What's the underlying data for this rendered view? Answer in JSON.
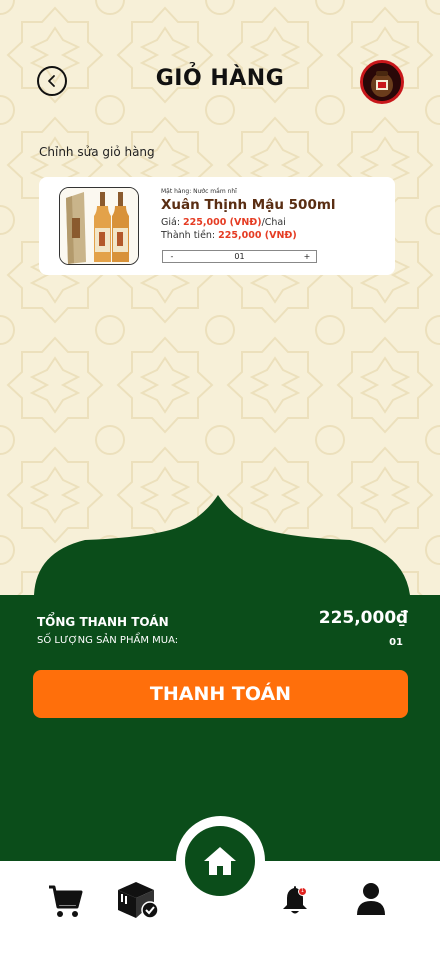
{
  "header": {
    "title": "GIỎ HÀNG"
  },
  "edit_cart_label": "Chỉnh sửa giỏ hàng",
  "cart_items": [
    {
      "category": "Mặt hàng: Nước mắm nhĩ",
      "name": "Xuân Thịnh Mậu 500ml",
      "price_label": "Giá: ",
      "price_value": "225,000 (VNĐ)",
      "price_unit": "/Chai",
      "total_label": "Thành tiền: ",
      "total_value": "225,000 (VNĐ)",
      "qty_minus": "-",
      "quantity": "01",
      "qty_plus": "+"
    }
  ],
  "summary": {
    "total_label": "TỔNG THANH TOÁN",
    "total_value": "225,000₫",
    "qty_label": "SỐ LƯỢNG SẢN PHẨM MUA:",
    "qty_value": "01"
  },
  "pay_button": "THANH TOÁN",
  "nav": {
    "items": [
      "cart-icon",
      "orders-icon",
      "home-icon",
      "bell-icon",
      "user-icon"
    ],
    "notification_badge": "1"
  },
  "colors": {
    "background": "#f7f0d8",
    "green": "#0b4d1a",
    "orange": "#ff6f0b",
    "price_red": "#e53c23",
    "product_brown": "#5a2e13"
  }
}
